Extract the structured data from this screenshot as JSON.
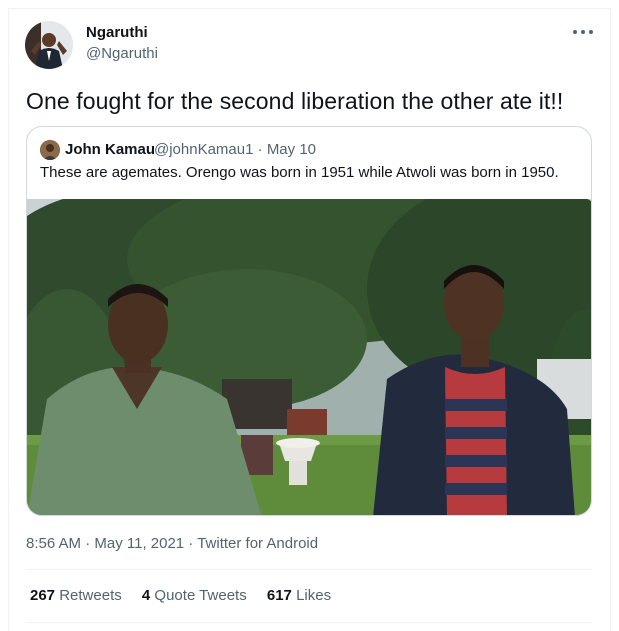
{
  "tweet": {
    "author_name": "Ngaruthi",
    "author_handle": "@Ngaruthi",
    "text": "One fought for the second liberation the other ate it!!",
    "timestamp": "8:56 AM · May 11, 2021 · Twitter for Android"
  },
  "quoted_tweet": {
    "author_name": "John Kamau",
    "author_handle": "@johnKamau1",
    "date": "May 10",
    "separator": "·",
    "text": "These are agemates. Orengo was born in 1951 while Atwoli was born in 1950."
  },
  "stats": {
    "retweets_count": "267",
    "retweets_label": "Retweets",
    "quote_count": "4",
    "quote_label": "Quote Tweets",
    "likes_count": "617",
    "likes_label": "Likes"
  },
  "colors": {
    "text_primary": "#0f1419",
    "text_secondary": "#536471",
    "border": "#cfd9de",
    "divider": "#eff3f4"
  },
  "icons": [
    "more-options-icon"
  ]
}
